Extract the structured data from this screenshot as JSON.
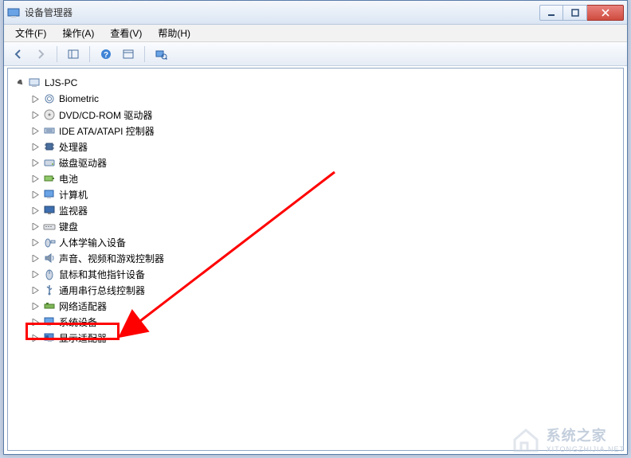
{
  "window": {
    "title": "设备管理器"
  },
  "menu": {
    "file": "文件(F)",
    "action": "操作(A)",
    "view": "查看(V)",
    "help": "帮助(H)"
  },
  "tree": {
    "root": "LJS-PC",
    "items": [
      "Biometric",
      "DVD/CD-ROM 驱动器",
      "IDE ATA/ATAPI 控制器",
      "处理器",
      "磁盘驱动器",
      "电池",
      "计算机",
      "监视器",
      "键盘",
      "人体学输入设备",
      "声音、视频和游戏控制器",
      "鼠标和其他指针设备",
      "通用串行总线控制器",
      "网络适配器",
      "系统设备",
      "显示适配器"
    ]
  },
  "watermark": {
    "text": "系统之家",
    "url": "XITONGZHIJIA.NET"
  }
}
